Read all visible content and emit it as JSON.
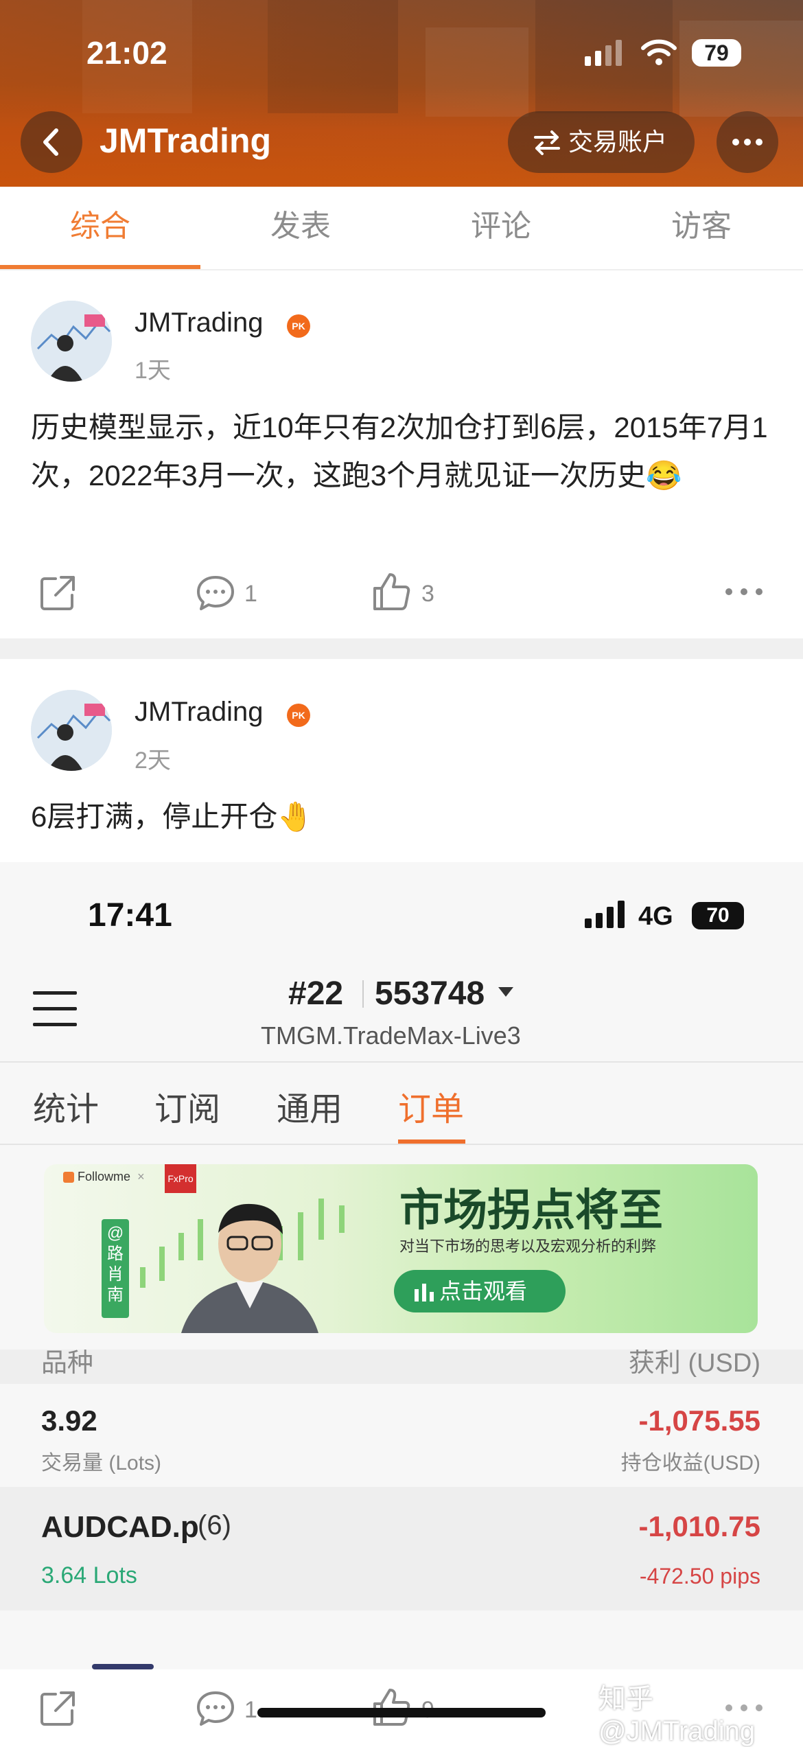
{
  "status_bar": {
    "time": "21:02",
    "battery": "79"
  },
  "nav": {
    "title": "JMTrading",
    "account_button": "交易账户"
  },
  "tabs": [
    "综合",
    "发表",
    "评论",
    "访客"
  ],
  "posts": [
    {
      "author": "JMTrading",
      "badge": "PK",
      "time": "1天",
      "text": "历史模型显示，近10年只有2次加仓打到6层，2015年7月1次，2022年3月一次，这跑3个月就见证一次历史😂",
      "comments": "1",
      "likes": "3"
    },
    {
      "author": "JMTrading",
      "badge": "PK",
      "time": "2天",
      "text": "6层打满，停止开仓🤚",
      "comments": "1",
      "likes": "9"
    }
  ],
  "embedded": {
    "status_time": "17:41",
    "network": "4G",
    "battery": "70",
    "account_no": "#22",
    "account_id": "553748",
    "server": "TMGM.TradeMax-Live3",
    "tabs": [
      "统计",
      "订阅",
      "通用",
      "订单"
    ],
    "banner": {
      "brand1": "Followme",
      "brand2": "FxPro",
      "side_tag": "@路肖南",
      "headline": "市场拐点将至",
      "sub": "对当下市场的思考以及宏观分析的利弊",
      "cta": "点击观看"
    },
    "table_header": {
      "left": "品种",
      "right": "获利 (USD)"
    },
    "summary": {
      "lots": "3.92",
      "lots_label": "交易量 (Lots)",
      "pnl": "-1,075.55",
      "pnl_label": "持仓收益(USD)"
    },
    "position": {
      "symbol": "AUDCAD.p",
      "count": "(6)",
      "lots": "3.64 Lots",
      "pnl": "-1,010.75",
      "pips": "-472.50 pips"
    }
  },
  "watermark": "知乎 @JMTrading"
}
